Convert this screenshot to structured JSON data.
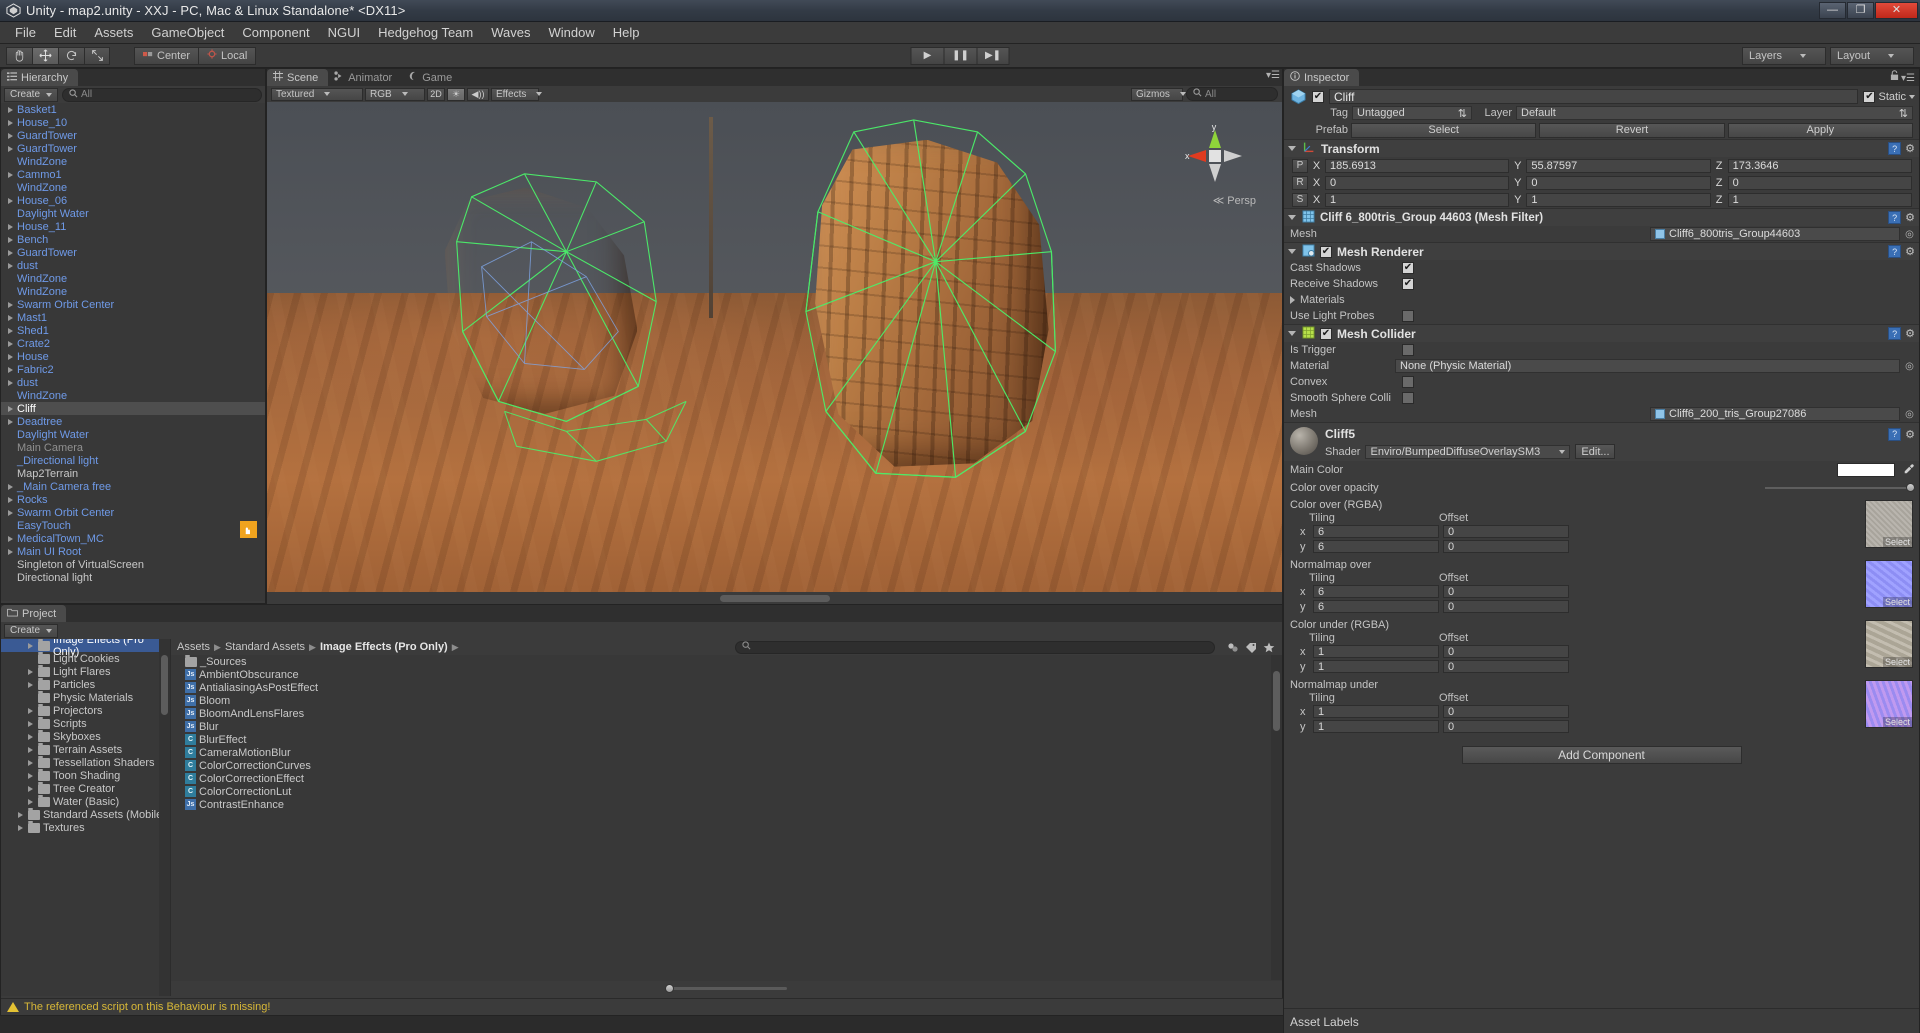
{
  "window": {
    "title": "Unity - map2.unity - XXJ - PC, Mac & Linux Standalone* <DX11>",
    "minimize": "—",
    "maximize": "❐",
    "close": "✕"
  },
  "menubar": {
    "items": [
      "File",
      "Edit",
      "Assets",
      "GameObject",
      "Component",
      "NGUI",
      "Hedgehog Team",
      "Waves",
      "Window",
      "Help"
    ]
  },
  "toolbar": {
    "tools": [
      "hand-tool",
      "move-tool",
      "rotate-tool",
      "scale-tool"
    ],
    "pivot_label": "Center",
    "space_label": "Local",
    "play": "▶",
    "pause": "❚❚",
    "step": "▶❚",
    "layers_label": "Layers",
    "layout_label": "Layout"
  },
  "hierarchy": {
    "tab": "Hierarchy",
    "create_label": "Create",
    "search_placeholder": "All",
    "items": [
      {
        "name": "Basket1",
        "arrow": true,
        "style": "prefab"
      },
      {
        "name": "House_10",
        "arrow": true,
        "style": "prefab"
      },
      {
        "name": "GuardTower",
        "arrow": true,
        "style": "prefab"
      },
      {
        "name": "GuardTower",
        "arrow": true,
        "style": "prefab"
      },
      {
        "name": "WindZone",
        "arrow": false,
        "style": "prefab"
      },
      {
        "name": "Cammo1",
        "arrow": true,
        "style": "prefab"
      },
      {
        "name": "WindZone",
        "arrow": false,
        "style": "prefab"
      },
      {
        "name": "House_06",
        "arrow": true,
        "style": "prefab"
      },
      {
        "name": "Daylight Water",
        "arrow": false,
        "style": "prefab"
      },
      {
        "name": "House_11",
        "arrow": true,
        "style": "prefab"
      },
      {
        "name": "Bench",
        "arrow": true,
        "style": "prefab"
      },
      {
        "name": "GuardTower",
        "arrow": true,
        "style": "prefab"
      },
      {
        "name": "dust",
        "arrow": true,
        "style": "prefab"
      },
      {
        "name": "WindZone",
        "arrow": false,
        "style": "prefab"
      },
      {
        "name": "WindZone",
        "arrow": false,
        "style": "prefab"
      },
      {
        "name": "Swarm Orbit Center",
        "arrow": true,
        "style": "prefab"
      },
      {
        "name": "Mast1",
        "arrow": true,
        "style": "prefab"
      },
      {
        "name": "Shed1",
        "arrow": true,
        "style": "prefab"
      },
      {
        "name": "Crate2",
        "arrow": true,
        "style": "prefab"
      },
      {
        "name": "House",
        "arrow": true,
        "style": "prefab"
      },
      {
        "name": "Fabric2",
        "arrow": true,
        "style": "prefab"
      },
      {
        "name": "dust",
        "arrow": true,
        "style": "prefab"
      },
      {
        "name": "WindZone",
        "arrow": false,
        "style": "prefab"
      },
      {
        "name": "Cliff",
        "arrow": true,
        "style": "selected"
      },
      {
        "name": "Deadtree",
        "arrow": true,
        "style": "prefab"
      },
      {
        "name": "Daylight Water",
        "arrow": false,
        "style": "prefab"
      },
      {
        "name": "Main Camera",
        "arrow": false,
        "style": "dim"
      },
      {
        "name": "_Directional light",
        "arrow": false,
        "style": "prefab"
      },
      {
        "name": "Map2Terrain",
        "arrow": false,
        "style": "plain"
      },
      {
        "name": "_Main Camera free",
        "arrow": true,
        "style": "prefab"
      },
      {
        "name": "Rocks",
        "arrow": true,
        "style": "prefab"
      },
      {
        "name": "Swarm Orbit Center",
        "arrow": true,
        "style": "prefab"
      },
      {
        "name": "EasyTouch",
        "arrow": false,
        "style": "prefab"
      },
      {
        "name": "MedicalTown_MC",
        "arrow": true,
        "style": "prefab"
      },
      {
        "name": "Main UI Root",
        "arrow": true,
        "style": "prefab"
      },
      {
        "name": "Singleton of VirtualScreen",
        "arrow": false,
        "style": "plain"
      },
      {
        "name": "Directional light",
        "arrow": false,
        "style": "plain"
      }
    ]
  },
  "scene": {
    "tabs": [
      {
        "label": "Scene",
        "icon": "scene-icon",
        "active": true
      },
      {
        "label": "Animator",
        "icon": "animator-icon",
        "active": false
      },
      {
        "label": "Game",
        "icon": "game-icon",
        "active": false
      }
    ],
    "draw_mode": "Textured",
    "color_mode": "RGB",
    "toggle_2d": "2D",
    "light_icon": "☀",
    "audio_icon": "◀))",
    "effects_label": "Effects",
    "gizmos_label": "Gizmos",
    "search_placeholder": "All",
    "gizmo": {
      "axis_x": "x",
      "axis_y": "y",
      "projection": "Persp"
    }
  },
  "inspector": {
    "tab": "Inspector",
    "object_name": "Cliff",
    "static_label": "Static",
    "tag_label": "Tag",
    "tag_value": "Untagged",
    "layer_label": "Layer",
    "layer_value": "Default",
    "prefab_label": "Prefab",
    "prefab_buttons": [
      "Select",
      "Revert",
      "Apply"
    ],
    "transform": {
      "title": "Transform",
      "rows": [
        {
          "badge": "P",
          "x": "185.6913",
          "y": "55.87597",
          "z": "173.3646"
        },
        {
          "badge": "R",
          "x": "0",
          "y": "0",
          "z": "0"
        },
        {
          "badge": "S",
          "x": "1",
          "y": "1",
          "z": "1"
        }
      ]
    },
    "mesh_filter": {
      "title": "Cliff 6_800tris_Group 44603 (Mesh Filter)",
      "mesh_label": "Mesh",
      "mesh_value": "Cliff6_800tris_Group44603"
    },
    "mesh_renderer": {
      "title": "Mesh Renderer",
      "enabled": true,
      "cast_shadows_label": "Cast Shadows",
      "cast_shadows": true,
      "receive_shadows_label": "Receive Shadows",
      "receive_shadows": true,
      "materials_label": "Materials",
      "use_light_probes_label": "Use Light Probes",
      "use_light_probes": false
    },
    "mesh_collider": {
      "title": "Mesh Collider",
      "enabled": true,
      "is_trigger_label": "Is Trigger",
      "is_trigger": false,
      "material_label": "Material",
      "material_value": "None (Physic Material)",
      "convex_label": "Convex",
      "convex": false,
      "smooth_sphere_label": "Smooth Sphere Colli",
      "smooth_sphere": false,
      "mesh_label": "Mesh",
      "mesh_value": "Cliff6_200_tris_Group27086"
    },
    "material": {
      "name": "Cliff5",
      "shader_label": "Shader",
      "shader_value": "Enviro/BumpedDiffuseOverlaySM3",
      "edit_label": "Edit...",
      "main_color_label": "Main Color",
      "main_color_value": "#FFFFFF",
      "color_over_opacity_label": "Color over opacity",
      "sections": [
        {
          "label": "Color over (RGBA)",
          "tiling_label": "Tiling",
          "offset_label": "Offset",
          "tiling_x": "6",
          "tiling_y": "6",
          "offset_x": "0",
          "offset_y": "0",
          "select_label": "Select",
          "tex_class": "tex-grey"
        },
        {
          "label": "Normalmap over",
          "tiling_label": "Tiling",
          "offset_label": "Offset",
          "tiling_x": "6",
          "tiling_y": "6",
          "offset_x": "0",
          "offset_y": "0",
          "select_label": "Select",
          "tex_class": "tex-norm"
        },
        {
          "label": "Color under (RGBA)",
          "tiling_label": "Tiling",
          "offset_label": "Offset",
          "tiling_x": "1",
          "tiling_y": "1",
          "offset_x": "0",
          "offset_y": "0",
          "select_label": "Select",
          "tex_class": "tex-grey2"
        },
        {
          "label": "Normalmap under",
          "tiling_label": "Tiling",
          "offset_label": "Offset",
          "tiling_x": "1",
          "tiling_y": "1",
          "offset_x": "0",
          "offset_y": "0",
          "select_label": "Select",
          "tex_class": "tex-norm2"
        }
      ]
    },
    "add_component_label": "Add Component",
    "asset_labels_title": "Asset Labels"
  },
  "project": {
    "tab": "Project",
    "create_label": "Create",
    "tree": [
      {
        "name": "Image Effects (Pro Only)",
        "indent": 2,
        "arrow": true,
        "selected": true
      },
      {
        "name": "Light Cookies",
        "indent": 2,
        "arrow": false,
        "selected": false
      },
      {
        "name": "Light Flares",
        "indent": 2,
        "arrow": true,
        "selected": false
      },
      {
        "name": "Particles",
        "indent": 2,
        "arrow": true,
        "selected": false
      },
      {
        "name": "Physic Materials",
        "indent": 2,
        "arrow": false,
        "selected": false
      },
      {
        "name": "Projectors",
        "indent": 2,
        "arrow": true,
        "selected": false
      },
      {
        "name": "Scripts",
        "indent": 2,
        "arrow": true,
        "selected": false
      },
      {
        "name": "Skyboxes",
        "indent": 2,
        "arrow": true,
        "selected": false
      },
      {
        "name": "Terrain Assets",
        "indent": 2,
        "arrow": true,
        "selected": false
      },
      {
        "name": "Tessellation Shaders",
        "indent": 2,
        "arrow": true,
        "selected": false
      },
      {
        "name": "Toon Shading",
        "indent": 2,
        "arrow": true,
        "selected": false
      },
      {
        "name": "Tree Creator",
        "indent": 2,
        "arrow": true,
        "selected": false
      },
      {
        "name": "Water (Basic)",
        "indent": 2,
        "arrow": true,
        "selected": false
      },
      {
        "name": "Standard Assets (Mobile)",
        "indent": 1,
        "arrow": true,
        "selected": false
      },
      {
        "name": "Textures",
        "indent": 1,
        "arrow": true,
        "selected": false
      }
    ],
    "breadcrumb": [
      "Assets",
      "Standard Assets",
      "Image Effects (Pro Only)"
    ],
    "search_placeholder": "",
    "files": [
      {
        "name": "_Sources",
        "type": "folder"
      },
      {
        "name": "AmbientObscurance",
        "type": "js"
      },
      {
        "name": "AntialiasingAsPostEffect",
        "type": "js"
      },
      {
        "name": "Bloom",
        "type": "js"
      },
      {
        "name": "BloomAndLensFlares",
        "type": "js"
      },
      {
        "name": "Blur",
        "type": "js"
      },
      {
        "name": "BlurEffect",
        "type": "cs"
      },
      {
        "name": "CameraMotionBlur",
        "type": "cs"
      },
      {
        "name": "ColorCorrectionCurves",
        "type": "cs"
      },
      {
        "name": "ColorCorrectionEffect",
        "type": "cs"
      },
      {
        "name": "ColorCorrectionLut",
        "type": "cs"
      },
      {
        "name": "ContrastEnhance",
        "type": "js"
      }
    ]
  },
  "statusbar": {
    "message": "The referenced script on this Behaviour is missing!"
  }
}
